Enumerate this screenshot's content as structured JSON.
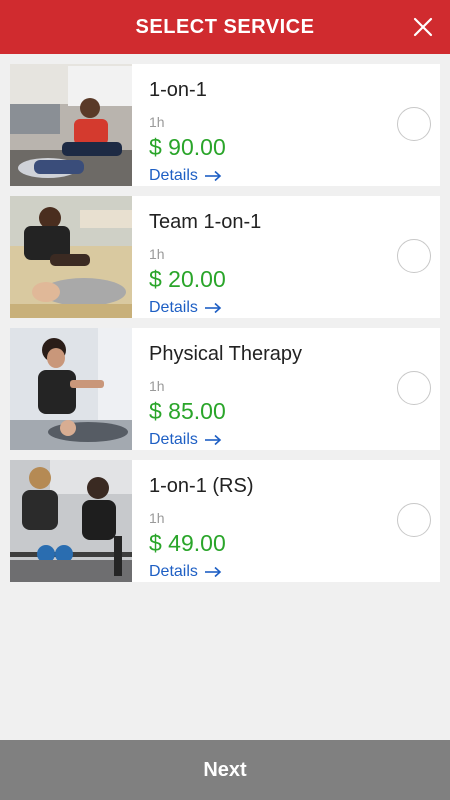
{
  "header": {
    "title": "SELECT SERVICE"
  },
  "services": [
    {
      "name": "1-on-1",
      "duration": "1h",
      "price": "$ 90.00",
      "details_label": "Details"
    },
    {
      "name": "Team 1-on-1",
      "duration": "1h",
      "price": "$ 20.00",
      "details_label": "Details"
    },
    {
      "name": "Physical Therapy",
      "duration": "1h",
      "price": "$ 85.00",
      "details_label": "Details"
    },
    {
      "name": "1-on-1 (RS)",
      "duration": "1h",
      "price": "$ 49.00",
      "details_label": "Details"
    }
  ],
  "footer": {
    "next_label": "Next"
  },
  "colors": {
    "header": "#d02b2f",
    "price": "#2aa52a",
    "link": "#1e5fc4",
    "footer": "#808080"
  }
}
